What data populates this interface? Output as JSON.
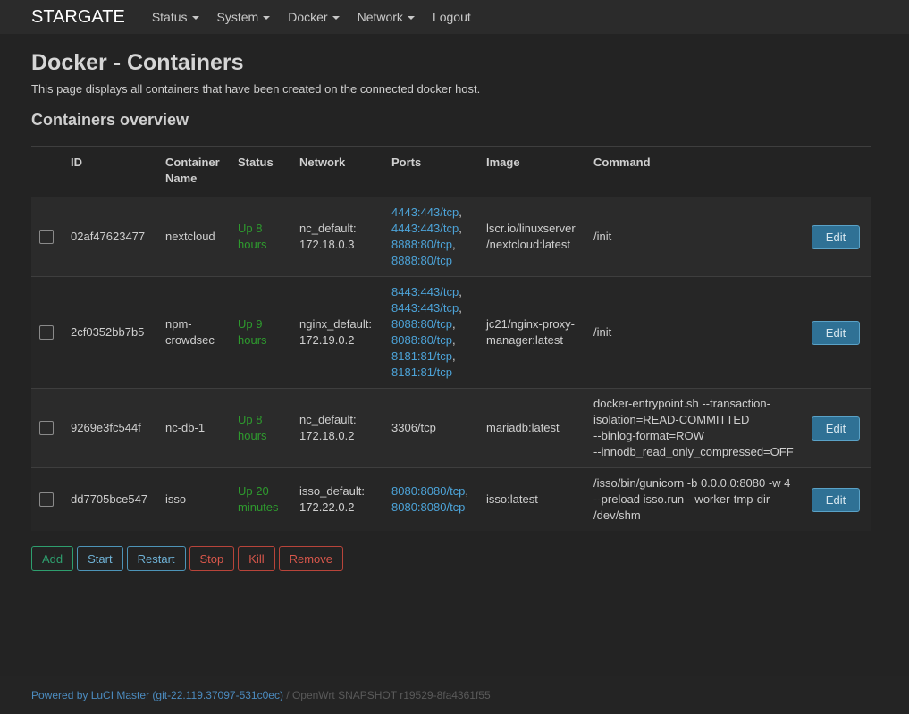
{
  "navbar": {
    "brand": "STARGATE",
    "menu": [
      {
        "label": "Status",
        "dropdown": true
      },
      {
        "label": "System",
        "dropdown": true
      },
      {
        "label": "Docker",
        "dropdown": true
      },
      {
        "label": "Network",
        "dropdown": true
      },
      {
        "label": "Logout",
        "dropdown": false
      }
    ]
  },
  "page": {
    "title": "Docker - Containers",
    "description": "This page displays all containers that have been created on the connected docker host.",
    "section_title": "Containers overview"
  },
  "table": {
    "headers": {
      "id": "ID",
      "name_line1": "Container",
      "name_line2": "Name",
      "status": "Status",
      "network": "Network",
      "ports": "Ports",
      "image": "Image",
      "command": "Command"
    },
    "rows": [
      {
        "id": "02af47623477",
        "name": [
          "nextcloud"
        ],
        "status": [
          "Up 8",
          "hours"
        ],
        "network": [
          "nc_default:",
          "172.18.0.3"
        ],
        "ports": [
          "4443:443/tcp",
          "4443:443/tcp",
          "8888:80/tcp",
          "8888:80/tcp"
        ],
        "ports_linked": true,
        "image": [
          "lscr.io/linuxserver",
          "/nextcloud:latest"
        ],
        "command": [
          "/init"
        ],
        "edit_label": "Edit"
      },
      {
        "id": "2cf0352bb7b5",
        "name": [
          "npm-",
          "crowdsec"
        ],
        "status": [
          "Up 9",
          "hours"
        ],
        "network": [
          "nginx_default:",
          "172.19.0.2"
        ],
        "ports": [
          "8443:443/tcp",
          "8443:443/tcp",
          "8088:80/tcp",
          "8088:80/tcp",
          "8181:81/tcp",
          "8181:81/tcp"
        ],
        "ports_linked": true,
        "image": [
          "jc21/nginx-proxy-",
          "manager:latest"
        ],
        "command": [
          "/init"
        ],
        "edit_label": "Edit"
      },
      {
        "id": "9269e3fc544f",
        "name": [
          "nc-db-1"
        ],
        "status": [
          "Up 8",
          "hours"
        ],
        "network": [
          "nc_default:",
          "172.18.0.2"
        ],
        "ports": [
          "3306/tcp"
        ],
        "ports_linked": false,
        "image": [
          "mariadb:latest"
        ],
        "command": [
          "docker-entrypoint.sh --transaction-",
          "isolation=READ-COMMITTED",
          "--binlog-format=ROW",
          "--innodb_read_only_compressed=OFF"
        ],
        "edit_label": "Edit"
      },
      {
        "id": "dd7705bce547",
        "name": [
          "isso"
        ],
        "status": [
          "Up 20",
          "minutes"
        ],
        "network": [
          "isso_default:",
          "172.22.0.2"
        ],
        "ports": [
          "8080:8080/tcp",
          "8080:8080/tcp"
        ],
        "ports_linked": true,
        "image": [
          "isso:latest"
        ],
        "command": [
          "/isso/bin/gunicorn -b 0.0.0.0:8080 -w 4",
          "--preload isso.run --worker-tmp-dir",
          "/dev/shm"
        ],
        "edit_label": "Edit"
      }
    ]
  },
  "actions": {
    "add": "Add",
    "start": "Start",
    "restart": "Restart",
    "stop": "Stop",
    "kill": "Kill",
    "remove": "Remove"
  },
  "footer": {
    "powered": "Powered by LuCI Master (git-22.119.37097-531c0ec)",
    "separator": " / ",
    "version": "OpenWrt SNAPSHOT r19529-8fa4361f55"
  },
  "colors": {
    "background": "#232323",
    "status_green": "#2e9a2e",
    "link_blue": "#4ca3d8",
    "edit_button": "#2f7195"
  }
}
